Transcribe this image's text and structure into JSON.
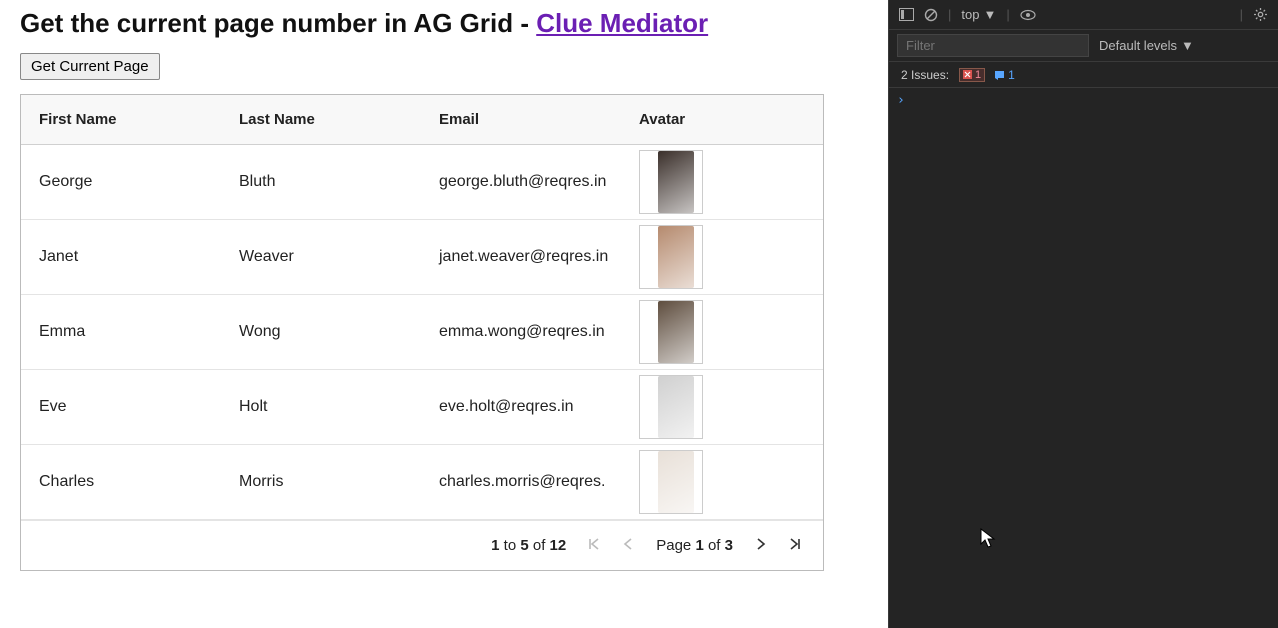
{
  "title": {
    "prefix": "Get the current page number in AG Grid - ",
    "link": "Clue Mediator"
  },
  "button": {
    "label": "Get Current Page"
  },
  "grid": {
    "headers": [
      "First Name",
      "Last Name",
      "Email",
      "Avatar"
    ],
    "rows": [
      {
        "first": "George",
        "last": "Bluth",
        "email": "george.bluth@reqres.in",
        "avcolor": "#3a2f2a"
      },
      {
        "first": "Janet",
        "last": "Weaver",
        "email": "janet.weaver@reqres.in",
        "avcolor": "#b58a6e"
      },
      {
        "first": "Emma",
        "last": "Wong",
        "email": "emma.wong@reqres.in",
        "avcolor": "#5e4d3e"
      },
      {
        "first": "Eve",
        "last": "Holt",
        "email": "eve.holt@reqres.in",
        "avcolor": "#d0d0d0"
      },
      {
        "first": "Charles",
        "last": "Morris",
        "email": "charles.morris@reqres.",
        "avcolor": "#e8e0d8"
      }
    ]
  },
  "paging": {
    "from": "1",
    "to": "5",
    "total": "12",
    "page": "1",
    "pages": "3",
    "of": "of",
    "toword": "to",
    "pageword": "Page"
  },
  "devtools": {
    "top": "top",
    "filterPlaceholder": "Filter",
    "levels": "Default levels",
    "issues": "2 Issues:",
    "errCount": "1",
    "infoCount": "1"
  }
}
